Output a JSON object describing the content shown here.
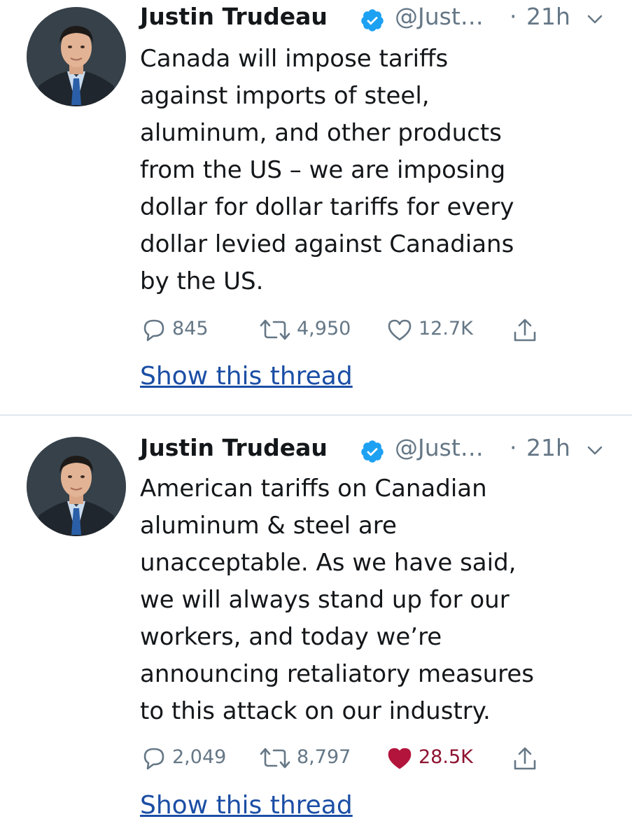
{
  "tweets": [
    {
      "author": "Justin Trudeau",
      "handle": "@Just…",
      "separator": "·",
      "time": "21h",
      "text": "Canada will impose tariffs\nagainst imports of steel,\naluminum, and other products\nfrom the US – we are imposing\ndollar for dollar tariffs for every\ndollar levied against Canadians\nby the US.",
      "replies": "845",
      "retweets": "4,950",
      "likes": "12.7K",
      "liked": false,
      "thread_link": "Show this thread"
    },
    {
      "author": "Justin Trudeau",
      "handle": "@Just…",
      "separator": "·",
      "time": "21h",
      "text": "American tariffs on Canadian\naluminum & steel are\nunacceptable. As we have said,\nwe will always stand up for our\nworkers, and today we’re\nannouncing retaliatory measures\nto this attack on our industry.",
      "replies": "2,049",
      "retweets": "8,797",
      "likes": "28.5K",
      "liked": true,
      "thread_link": "Show this thread"
    }
  ],
  "icons": {
    "verified": "verified-badge-icon",
    "caret": "chevron-down-icon",
    "reply": "reply-icon",
    "retweet": "retweet-icon",
    "like": "heart-icon",
    "share": "share-icon"
  },
  "colors": {
    "verified_blue": "#1da1f2",
    "liked_red": "#b3143c",
    "link_blue": "#1b4ea5",
    "muted": "#657786",
    "text": "#14171a"
  }
}
